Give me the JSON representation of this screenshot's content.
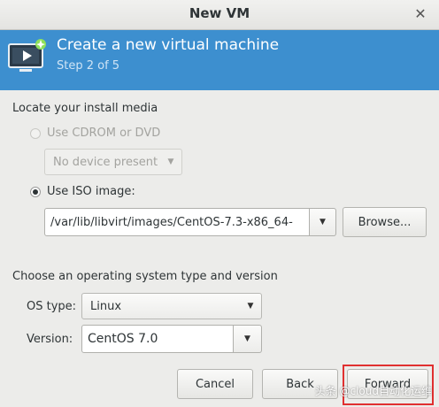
{
  "window": {
    "title": "New VM"
  },
  "banner": {
    "title": "Create a new virtual machine",
    "step": "Step 2 of 5",
    "accent_color": "#3d8fcf"
  },
  "install_media": {
    "section_label": "Locate your install media",
    "cdrom_label": "Use CDROM or DVD",
    "cdrom_combo_value": "No device present",
    "iso_label": "Use ISO image:",
    "iso_path": "/var/lib/libvirt/images/CentOS-7.3-x86_64-",
    "browse_label": "Browse..."
  },
  "os_selection": {
    "section_label": "Choose an operating system type and version",
    "os_type_label": "OS type:",
    "os_type_value": "Linux",
    "version_label": "Version:",
    "version_value": "CentOS 7.0"
  },
  "buttons": {
    "cancel": "Cancel",
    "back": "Back",
    "forward": "Forward"
  },
  "watermark": "头条 @cloud自动化运维"
}
